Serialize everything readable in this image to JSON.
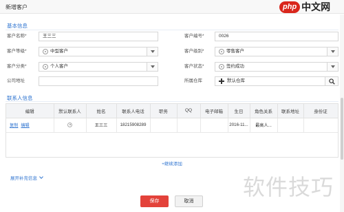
{
  "dialog": {
    "title": "新增客户"
  },
  "logo": {
    "badge": "php",
    "text": "中文网"
  },
  "colors": {
    "accent": "#2f74d0",
    "save_button": "#e3423a",
    "table_header_bg": "#f3f4f6"
  },
  "icons": {
    "select_prefix": "circle-icon",
    "select_arrow": "chevron-down-icon",
    "warehouse_add": "plus-icon",
    "warehouse_lookup": "search-icon",
    "expand_toggle": "chevron-down-icon",
    "default_contact": "radio-icon"
  },
  "basic_info": {
    "title": "基本信息",
    "customer_name": {
      "label": "客户名称*",
      "value": "王三三"
    },
    "customer_code": {
      "label": "客户编号*",
      "value": "0026"
    },
    "customer_grade": {
      "label": "客户等级*",
      "value": "中型客户"
    },
    "customer_level": {
      "label": "客户级别*",
      "value": "零售客户"
    },
    "customer_category": {
      "label": "客户分类*",
      "value": "个人客户"
    },
    "customer_status": {
      "label": "客户状态*",
      "value": "签约成功"
    },
    "company_address": {
      "label": "公司地址"
    },
    "warehouse": {
      "label": "所属仓库",
      "value": "默认仓库"
    }
  },
  "contacts": {
    "title": "联系人信息",
    "columns": [
      "编辑",
      "默认联系人",
      "姓名",
      "联系人电话",
      "职务",
      "QQ",
      "电子邮箱",
      "生日",
      "角色关系",
      "联系地址",
      "身份证"
    ],
    "rows": [
      {
        "actions": [
          "复制",
          "编辑"
        ],
        "is_default": true,
        "name": "王三三",
        "phone": "18215908289",
        "birthday": "2016-11...",
        "role": "最高人..."
      }
    ],
    "add_more": "+继续添加"
  },
  "supplement": {
    "toggle": "展开补充信息"
  },
  "footer": {
    "save": "保存",
    "cancel": "取消"
  },
  "watermark": {
    "text": "软件技巧"
  }
}
